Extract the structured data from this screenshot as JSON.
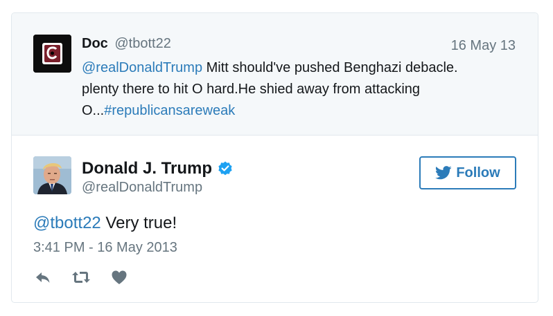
{
  "quoted_tweet": {
    "name": "Doc",
    "handle": "@tbott22",
    "date": "16 May 13",
    "mention": "@realDonaldTrump",
    "text": " Mitt should've pushed Benghazi debacle. plenty there to hit O hard.He shied away from attacking O...",
    "hashtag": "#republicansareweak",
    "avatar_icon": "university-logo-icon"
  },
  "tweet": {
    "name": "Donald J. Trump",
    "handle": "@realDonaldTrump",
    "verified_icon": "verified-badge-icon",
    "mention": "@tbott22",
    "text": " Very true!",
    "timestamp": "3:41 PM - 16 May 2013",
    "follow_label": "Follow"
  },
  "actions": [
    "reply-icon",
    "retweet-icon",
    "like-icon"
  ],
  "colors": {
    "link": "#2b7bb9",
    "muted": "#66757f",
    "quoted_bg": "#f5f8fa",
    "border": "#e1e8ed",
    "verified": "#1da1f2",
    "action_icon": "#66757f"
  }
}
